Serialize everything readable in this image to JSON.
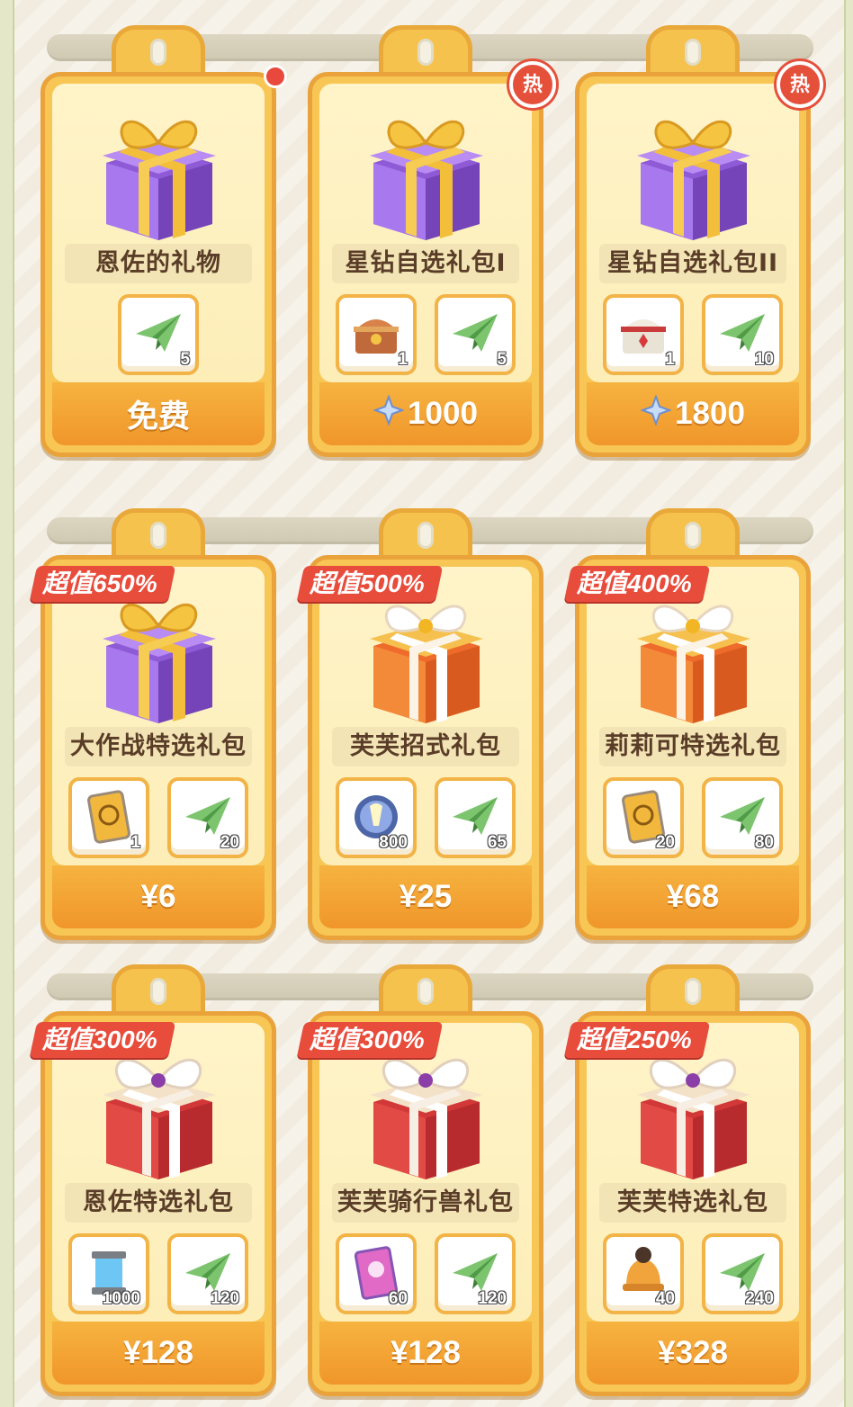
{
  "colors": {
    "card": "#f7c654",
    "price_bar": "#f0962a",
    "badge": "#e84d3c"
  },
  "rows": [
    {
      "cards": [
        {
          "name": "恩佐的礼物",
          "gift": "purple",
          "badge_type": "dot",
          "items": [
            {
              "icon": "paper-plane-icon",
              "qty": "5"
            }
          ],
          "price": "免费",
          "currency": "none"
        },
        {
          "name": "星钻自选礼包I",
          "gift": "purple",
          "badge_type": "hot",
          "hot_label": "热",
          "items": [
            {
              "icon": "treasure-chest-icon",
              "qty": "1"
            },
            {
              "icon": "paper-plane-icon",
              "qty": "5"
            }
          ],
          "price": "1000",
          "currency": "star"
        },
        {
          "name": "星钻自选礼包II",
          "gift": "purple",
          "badge_type": "hot",
          "hot_label": "热",
          "items": [
            {
              "icon": "gold-chest-icon",
              "qty": "1"
            },
            {
              "icon": "paper-plane-icon",
              "qty": "10"
            }
          ],
          "price": "1800",
          "currency": "star"
        }
      ]
    },
    {
      "cards": [
        {
          "name": "大作战特选礼包",
          "gift": "purple",
          "promo": "超值650%",
          "items": [
            {
              "icon": "card-icon",
              "qty": "1"
            },
            {
              "icon": "paper-plane-icon",
              "qty": "20"
            }
          ],
          "price": "¥6"
        },
        {
          "name": "芙芙招式礼包",
          "gift": "orange",
          "promo": "超值500%",
          "items": [
            {
              "icon": "crystal-orb-icon",
              "qty": "800"
            },
            {
              "icon": "paper-plane-icon",
              "qty": "65"
            }
          ],
          "price": "¥25"
        },
        {
          "name": "莉莉可特选礼包",
          "gift": "orange",
          "promo": "超值400%",
          "items": [
            {
              "icon": "card-icon",
              "qty": "20"
            },
            {
              "icon": "paper-plane-icon",
              "qty": "80"
            }
          ],
          "price": "¥68"
        }
      ]
    },
    {
      "cards": [
        {
          "name": "恩佐特选礼包",
          "gift": "red",
          "promo": "超值300%",
          "items": [
            {
              "icon": "energy-canister-icon",
              "qty": "1000"
            },
            {
              "icon": "paper-plane-icon",
              "qty": "120"
            }
          ],
          "price": "¥128"
        },
        {
          "name": "芙芙骑行兽礼包",
          "gift": "red",
          "promo": "超值300%",
          "items": [
            {
              "icon": "pink-card-icon",
              "qty": "60"
            },
            {
              "icon": "paper-plane-icon",
              "qty": "120"
            }
          ],
          "price": "¥128"
        },
        {
          "name": "芙芙特选礼包",
          "gift": "red",
          "promo": "超值250%",
          "items": [
            {
              "icon": "bell-icon",
              "qty": "40"
            },
            {
              "icon": "paper-plane-icon",
              "qty": "240"
            }
          ],
          "price": "¥328"
        }
      ]
    }
  ]
}
